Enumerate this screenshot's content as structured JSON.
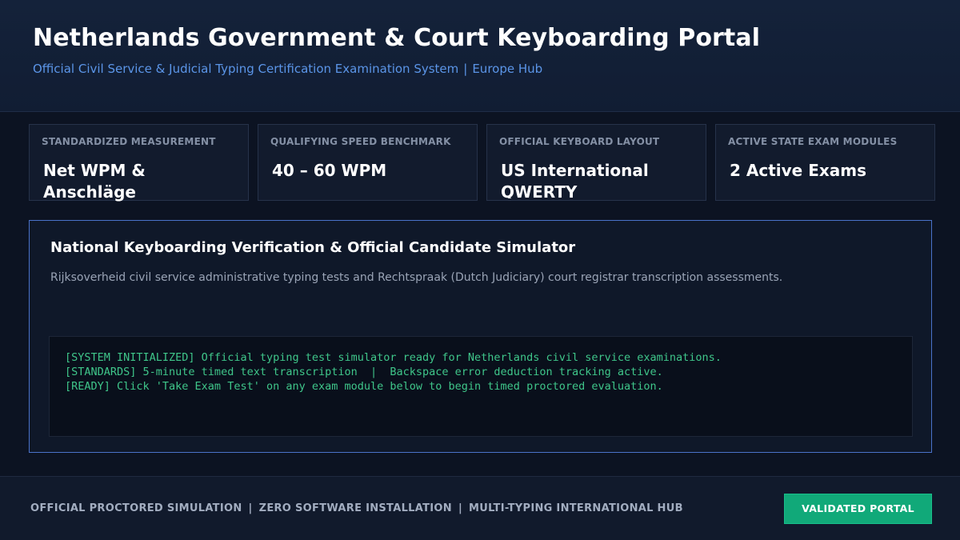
{
  "header": {
    "title": "Netherlands Government & Court Keyboarding Portal",
    "subtitle_main": "Official Civil Service & Judicial Typing Certification Examination System",
    "subtitle_separator": "|",
    "subtitle_region": "Europe Hub"
  },
  "stats": [
    {
      "label": "STANDARDIZED MEASUREMENT",
      "value": "Net WPM & Anschläge"
    },
    {
      "label": "QUALIFYING SPEED BENCHMARK",
      "value": "40 – 60 WPM"
    },
    {
      "label": "OFFICIAL KEYBOARD LAYOUT",
      "value": "US International QWERTY"
    },
    {
      "label": "ACTIVE STATE EXAM MODULES",
      "value": "2 Active Exams"
    }
  ],
  "simulator": {
    "title": "National Keyboarding Verification & Official Candidate Simulator",
    "description": "Rijksoverheid civil service administrative typing tests and Rechtspraak (Dutch Judiciary) court registrar transcription assessments.",
    "console_lines": [
      "[SYSTEM INITIALIZED] Official typing test simulator ready for Netherlands civil service examinations.",
      "[STANDARDS] 5-minute timed text transcription  |  Backspace error deduction tracking active.",
      "[READY] Click 'Take Exam Test' on any exam module below to begin timed proctored evaluation."
    ]
  },
  "footer": {
    "tags": [
      "OFFICIAL PROCTORED SIMULATION",
      "ZERO SOFTWARE INSTALLATION",
      "MULTI-TYPING INTERNATIONAL HUB"
    ],
    "separator": "|",
    "validated_label": "VALIDATED PORTAL"
  },
  "colors": {
    "accent_blue": "#5b95e8",
    "console_green": "#3fc68a",
    "button_green": "#11a979"
  }
}
